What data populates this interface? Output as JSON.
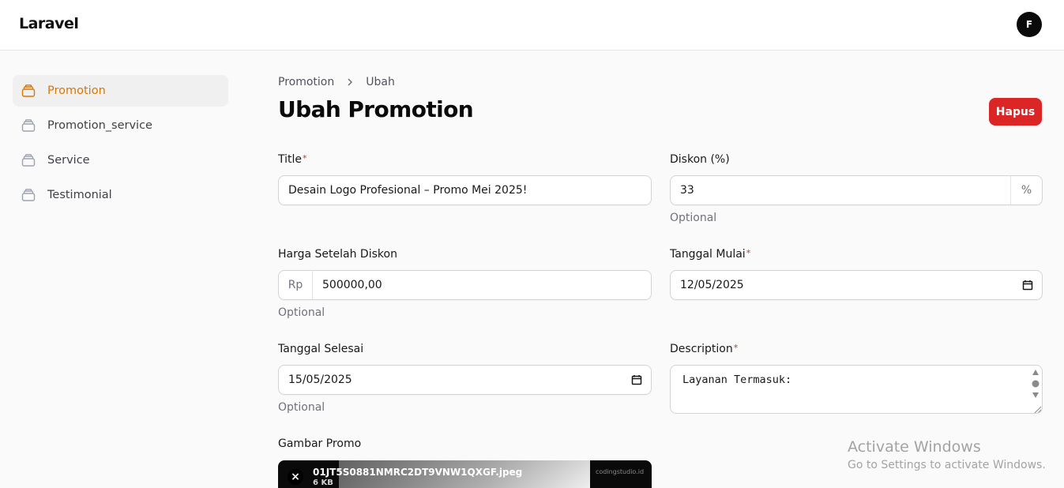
{
  "app": {
    "brand": "Laravel",
    "user_initial": "F"
  },
  "sidebar": {
    "items": [
      {
        "label": "Promotion",
        "icon": "stack-icon",
        "active": true
      },
      {
        "label": "Promotion_service",
        "icon": "stack-icon",
        "active": false
      },
      {
        "label": "Service",
        "icon": "stack-icon",
        "active": false
      },
      {
        "label": "Testimonial",
        "icon": "stack-icon",
        "active": false
      }
    ]
  },
  "breadcrumb": {
    "parent": "Promotion",
    "current": "Ubah"
  },
  "page": {
    "title": "Ubah Promotion",
    "delete_label": "Hapus"
  },
  "form": {
    "title": {
      "label": "Title",
      "required": "*",
      "value": "Desain Logo Profesional – Promo Mei 2025!"
    },
    "discount": {
      "label": "Diskon (%)",
      "value": "33",
      "suffix": "%",
      "hint": "Optional"
    },
    "price_after": {
      "label": "Harga Setelah Diskon",
      "prefix": "Rp",
      "value": "500000,00",
      "hint": "Optional"
    },
    "start_date": {
      "label": "Tanggal Mulai",
      "required": "*",
      "value": "12/05/2025"
    },
    "end_date": {
      "label": "Tanggal Selesai",
      "value": "15/05/2025",
      "hint": "Optional"
    },
    "description": {
      "label": "Description",
      "required": "*",
      "value": "Layanan Termasuk:"
    },
    "image": {
      "label": "Gambar Promo",
      "file_name": "01JT5S0881NMRC2DT9VNW1QXGF.jpeg",
      "file_size": "6 KB",
      "watermark": "codingstudio.id",
      "close_symbol": "×"
    }
  },
  "os_watermark": {
    "title": "Activate Windows",
    "subtitle": "Go to Settings to activate Windows."
  },
  "colors": {
    "accent": "#d97706",
    "danger": "#dc2626",
    "avatar_bg": "#0a0a0a"
  }
}
